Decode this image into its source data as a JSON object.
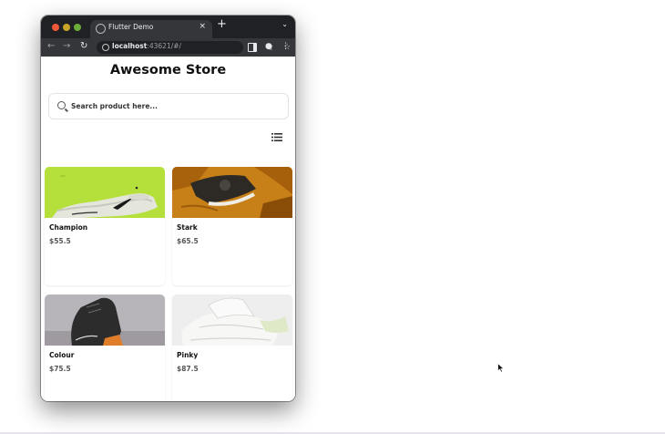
{
  "browser": {
    "tab_title": "Flutter Demo",
    "tab_close": "×",
    "new_tab": "+",
    "tab_menu": "⌄",
    "url_host": "localhost",
    "url_rest": ":43621/#/",
    "nav": {
      "back": "←",
      "forward": "→",
      "reload": "↻"
    },
    "icons": {
      "share": "⇪",
      "star": "☆",
      "profile": "●",
      "menu": "⋮"
    }
  },
  "page": {
    "title": "Awesome Store",
    "search": {
      "placeholder": "Search product here..."
    }
  },
  "products": [
    {
      "name": "Champion",
      "price": "$55.5"
    },
    {
      "name": "Stark",
      "price": "$65.5"
    },
    {
      "name": "Colour",
      "price": "$75.5"
    },
    {
      "name": "Pinky",
      "price": "$87.5"
    }
  ],
  "colors": {
    "tabbar": "#202124",
    "toolbar": "#35363a",
    "champion_bg": "#b5e03b",
    "stark_bg": "#c77f18"
  }
}
